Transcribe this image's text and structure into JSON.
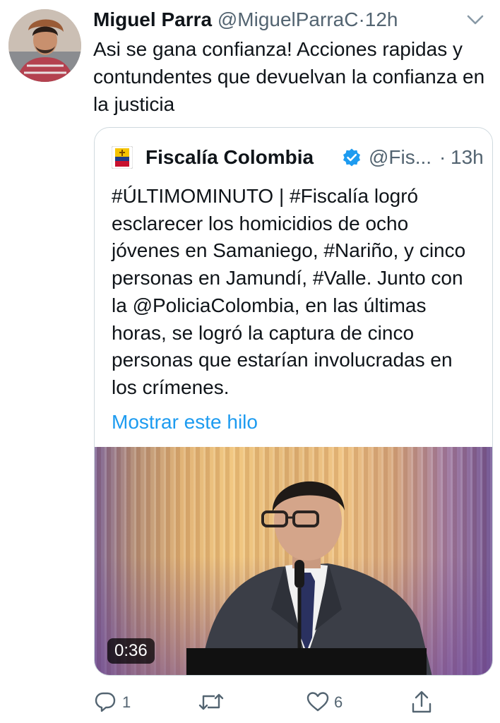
{
  "tweet": {
    "author_name": "Miguel Parra",
    "author_handle": "@MiguelParraC",
    "separator": "·",
    "time": "12h",
    "text": "Asi se gana confianza! Acciones rapidas y contundentes que devuelvan la confianza en la justicia"
  },
  "quote": {
    "author_name": "Fiscalía Colombia",
    "author_handle": "@Fis...",
    "separator": "·",
    "time": "13h",
    "text": "#ÚLTIMOMINUTO | #Fiscalía logró esclarecer los homicidios de ocho jóvenes en Samaniego, #Nariño, y cinco personas en Jamundí, #Valle. Junto con la @PoliciaColombia, en las últimas horas, se logró la captura de cinco personas que estarían involucradas en los crímenes.",
    "show_thread_label": "Mostrar este hilo",
    "video_duration": "0:36"
  },
  "actions": {
    "reply_count": "1",
    "retweet_count": "",
    "like_count": "6"
  },
  "colors": {
    "link": "#1d9bf0",
    "verified": "#1d9bf0",
    "secondary_text": "#536471"
  },
  "icons": [
    "chevron-down-icon",
    "verified-badge-icon",
    "reply-icon",
    "retweet-icon",
    "like-icon",
    "share-icon"
  ]
}
